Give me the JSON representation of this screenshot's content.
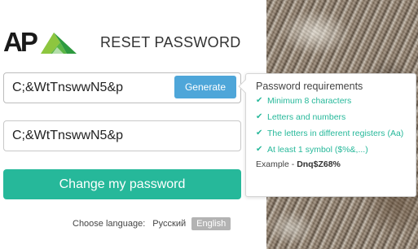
{
  "logo": {
    "text": "AP",
    "mark_icon": "green-triangle-logo-icon",
    "colors": {
      "text": "#1a1a1a",
      "mark_light": "#8dc63f",
      "mark_dark": "#2e9a3f"
    }
  },
  "page_title": "RESET PASSWORD",
  "form": {
    "new_password": {
      "value": "C;&WtTnswwN5&p"
    },
    "generate_label": "Generate",
    "confirm_password": {
      "value": "C;&WtTnswwN5&p"
    },
    "submit_label": "Change my password"
  },
  "tooltip": {
    "title": "Password requirements",
    "requirements": [
      {
        "text": "Minimum 8 characters",
        "icon": "check-icon"
      },
      {
        "text": "Letters and numbers",
        "icon": "check-icon"
      },
      {
        "text": "The letters in different registers (Aa)",
        "icon": "check-icon"
      },
      {
        "text": "At least 1 symbol ($%&,...)",
        "icon": "check-icon"
      }
    ],
    "example_label": "Example - ",
    "example_value": "Dnq$Z68%"
  },
  "language": {
    "label": "Choose language:",
    "options": [
      "Русский",
      "English"
    ],
    "selected": "English"
  },
  "colors": {
    "generate_button": "#4ea6d9",
    "submit_button": "#26b89a",
    "requirement_text": "#26b89a",
    "selected_language_bg": "#b3b3b3"
  }
}
